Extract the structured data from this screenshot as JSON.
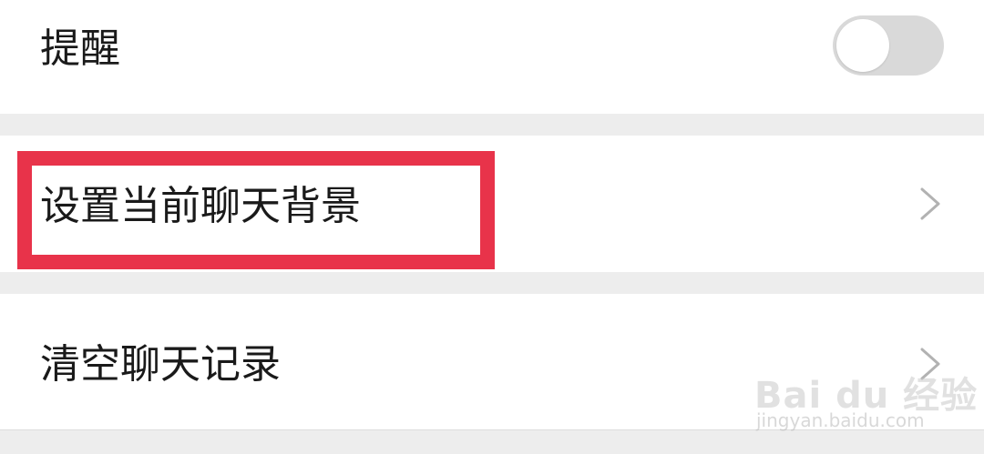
{
  "settings": {
    "reminder": {
      "label": "提醒",
      "toggle_on": false
    },
    "set_background": {
      "label": "设置当前聊天背景"
    },
    "clear_history": {
      "label": "清空聊天记录"
    }
  },
  "annotation": {
    "highlight_color": "#e8334a"
  },
  "watermark": {
    "main": "Bai du 经验",
    "sub": "jingyan.baidu.com"
  },
  "colors": {
    "background": "#ededed",
    "row": "#ffffff",
    "text": "#1a1a1a",
    "toggle_off": "#d9d9d9",
    "chevron": "#b2b2b2"
  },
  "icons": {
    "chevron": "chevron-right-icon"
  }
}
